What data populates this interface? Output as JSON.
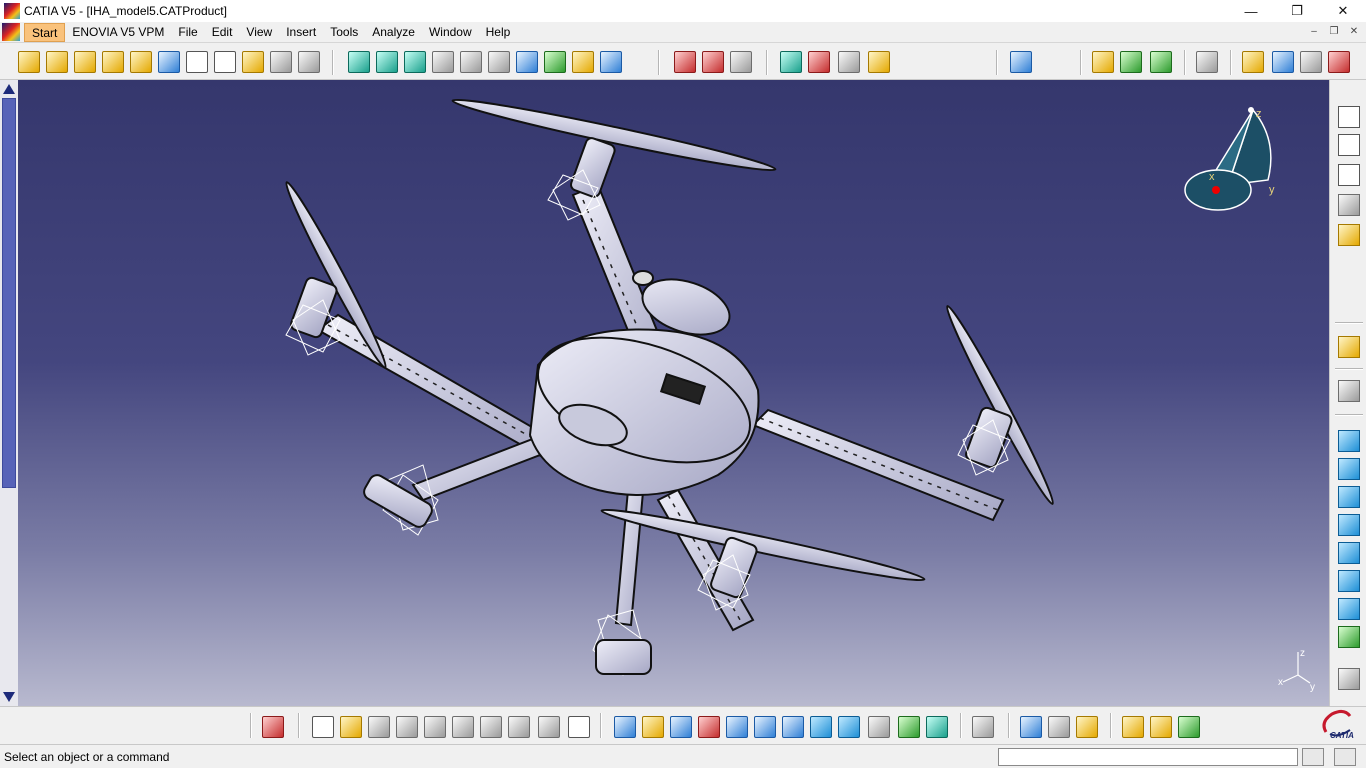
{
  "window": {
    "title": "CATIA V5 - [IHA_model5.CATProduct]",
    "controls": {
      "minimize": "—",
      "maximize": "❐",
      "close": "✕"
    }
  },
  "menubar": {
    "items": [
      "Start",
      "ENOVIA V5 VPM",
      "File",
      "Edit",
      "View",
      "Insert",
      "Tools",
      "Analyze",
      "Window",
      "Help"
    ],
    "mdi_controls": [
      "–",
      "❐",
      "✕"
    ]
  },
  "viewport": {
    "model_name": "IHA_model5",
    "compass_axes": [
      "z",
      "x",
      "y"
    ],
    "triad_axes": [
      "z",
      "x",
      "y"
    ]
  },
  "status": {
    "message": "Select an object or a command",
    "command_input_value": ""
  },
  "colors": {
    "viewport_top": "#35376d",
    "viewport_bottom": "#b8b9cf",
    "model_fill": "#d9d9ea",
    "model_stroke": "#111111"
  },
  "icons": {
    "top_toolbar": [
      "product-structure-icon",
      "component-icon",
      "part-icon",
      "insert-existing-component-icon",
      "replace-component-icon",
      "graph-tree-reordering-icon",
      "generate-numbering-icon",
      "selective-load-icon",
      "manage-representations-icon",
      "multi-instantiation-icon",
      "fast-multi-instantiation-icon",
      "manipulation-icon",
      "snap-icon",
      "explode-icon",
      "stop-manipulate-on-clash-icon",
      "smart-move-icon",
      "coincidence-constraint-icon",
      "contact-constraint-icon",
      "offset-constraint-icon",
      "angle-constraint-icon",
      "fix-component-icon",
      "fix-together-icon",
      "quick-constraint-icon",
      "flexible-rigid-icon",
      "change-constraint-icon",
      "reuse-pattern-icon",
      "update-icon",
      "clash-icon",
      "sectioning-icon",
      "distance-analysis-icon",
      "measure-between-icon",
      "measure-item-icon",
      "measure-inertia-icon",
      "scene-icon",
      "catalog-browser-icon",
      "publish-icon",
      "knowledge-icon",
      "apply-material-icon"
    ],
    "bottom_toolbar": [
      "select-icon",
      "new-icon",
      "open-icon",
      "save-icon",
      "print-icon",
      "cut-icon",
      "copy-icon",
      "paste-icon",
      "undo-icon",
      "redo-icon",
      "whats-this-icon",
      "fly-mode-icon",
      "fit-all-icon",
      "pan-icon",
      "rotate-icon",
      "zoom-in-icon",
      "zoom-out-icon",
      "normal-view-icon",
      "multi-view-icon",
      "isometric-view-icon",
      "shading-icon",
      "hide-show-icon",
      "swap-visible-space-icon",
      "update-all-icon",
      "measure-icon",
      "properties-icon",
      "apply-material-icon",
      "render-icon",
      "photo-studio-icon"
    ],
    "right_toolbar": [
      "annotation-text-icon",
      "flag-note-icon",
      "weld-annotation-icon",
      "view-icon",
      "capture-icon",
      "select-arrow-icon",
      "gear-icon",
      "cube-view-front-icon",
      "cube-view-back-icon",
      "cube-view-left-icon",
      "cube-view-right-icon",
      "cube-view-top-icon",
      "cube-view-bottom-icon",
      "cube-view-iso-icon",
      "image-capture-icon",
      "tools-options-icon"
    ]
  }
}
